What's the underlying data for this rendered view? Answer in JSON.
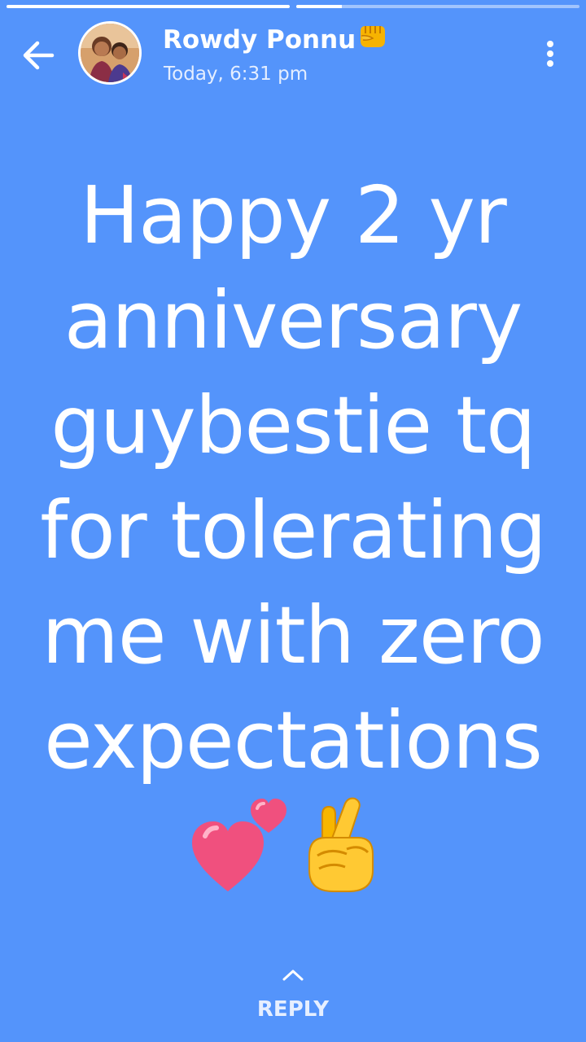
{
  "status": {
    "progress_segments": [
      1.0,
      0.16
    ]
  },
  "header": {
    "name": "Rowdy Ponnu",
    "time": "Today, 6:31 pm",
    "icons": [
      "back-arrow-icon",
      "avatar",
      "oncoming-fist-icon",
      "more-vertical-icon"
    ]
  },
  "message": {
    "lines": [
      "Happy 2 yr",
      "anniversary",
      "guybestie tq",
      "for tolerating",
      "me with zero",
      "expectations"
    ],
    "emoji_icons": [
      "two-hearts-icon",
      "crossed-fingers-icon"
    ]
  },
  "reply": {
    "label": "REPLY"
  },
  "colors": {
    "background": "#5494fb",
    "text": "#ffffff"
  }
}
